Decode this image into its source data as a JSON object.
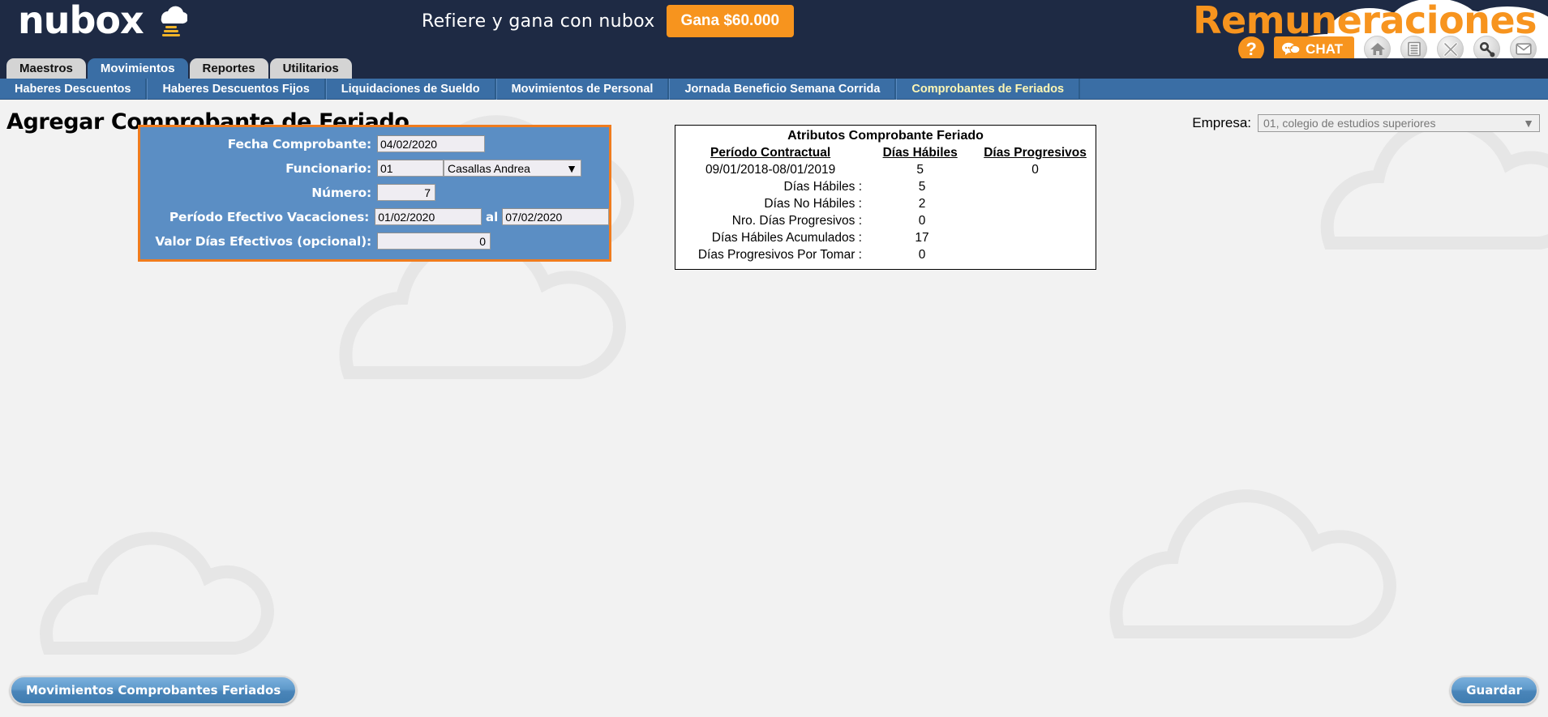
{
  "header": {
    "logo_text": "nubox",
    "logo_cloud_icon": "cloud-icon",
    "promo_text": "Refiere y gana con nubox",
    "promo_button": "Gana $60.000",
    "brand_title": "Remuneraciones",
    "help_label": "?",
    "chat_label": "CHAT",
    "tool_icons": [
      "home-icon",
      "document-icon",
      "close-icon",
      "key-icon",
      "mail-icon"
    ],
    "accent_orange": "#f7941e",
    "dark_navy": "#1e2a44"
  },
  "tabs": [
    {
      "label": "Maestros",
      "active": false
    },
    {
      "label": "Movimientos",
      "active": true
    },
    {
      "label": "Reportes",
      "active": false
    },
    {
      "label": "Utilitarios",
      "active": false
    }
  ],
  "subtabs": [
    {
      "label": "Haberes Descuentos",
      "active": false
    },
    {
      "label": "Haberes Descuentos Fijos",
      "active": false
    },
    {
      "label": "Liquidaciones de Sueldo",
      "active": false
    },
    {
      "label": "Movimientos de Personal",
      "active": false
    },
    {
      "label": "Jornada Beneficio Semana Corrida",
      "active": false
    },
    {
      "label": "Comprobantes de Feriados",
      "active": true
    }
  ],
  "page": {
    "title": "Agregar Comprobante de Feriado"
  },
  "empresa": {
    "label": "Empresa:",
    "value": "01, colegio de estudios superiores",
    "caret": "▼"
  },
  "form": {
    "fecha_label": "Fecha Comprobante:",
    "fecha_value": "04/02/2020",
    "funcionario_label": "Funcionario:",
    "funcionario_code": "01",
    "funcionario_name": "Casallas Andrea",
    "funcionario_caret": "▼",
    "numero_label": "Número:",
    "numero_value": "7",
    "periodo_label": "Período Efectivo Vacaciones:",
    "periodo_desde": "01/02/2020",
    "periodo_conector": "al",
    "periodo_hasta": "07/02/2020",
    "valor_label": "Valor Días Efectivos (opcional):",
    "valor_value": "0",
    "border_color": "#f07c1e",
    "panel_color": "#5b8ec4"
  },
  "attributes": {
    "title": "Atributos Comprobante Feriado",
    "headers": [
      "Período Contractual",
      "Días Hábiles",
      "Días Progresivos"
    ],
    "row": {
      "periodo": "09/01/2018-08/01/2019",
      "habiles": "5",
      "progresivos": "0"
    },
    "lines": [
      {
        "label": "Días Hábiles :",
        "value": "5"
      },
      {
        "label": "Días No Hábiles :",
        "value": "2"
      },
      {
        "label": "Nro. Días Progresivos :",
        "value": "0"
      },
      {
        "label": "Días Hábiles Acumulados :",
        "value": "17"
      },
      {
        "label": "Días Progresivos Por Tomar :",
        "value": "0"
      }
    ]
  },
  "footer": {
    "movimientos_button": "Movimientos Comprobantes Feriados",
    "guardar_button": "Guardar"
  }
}
